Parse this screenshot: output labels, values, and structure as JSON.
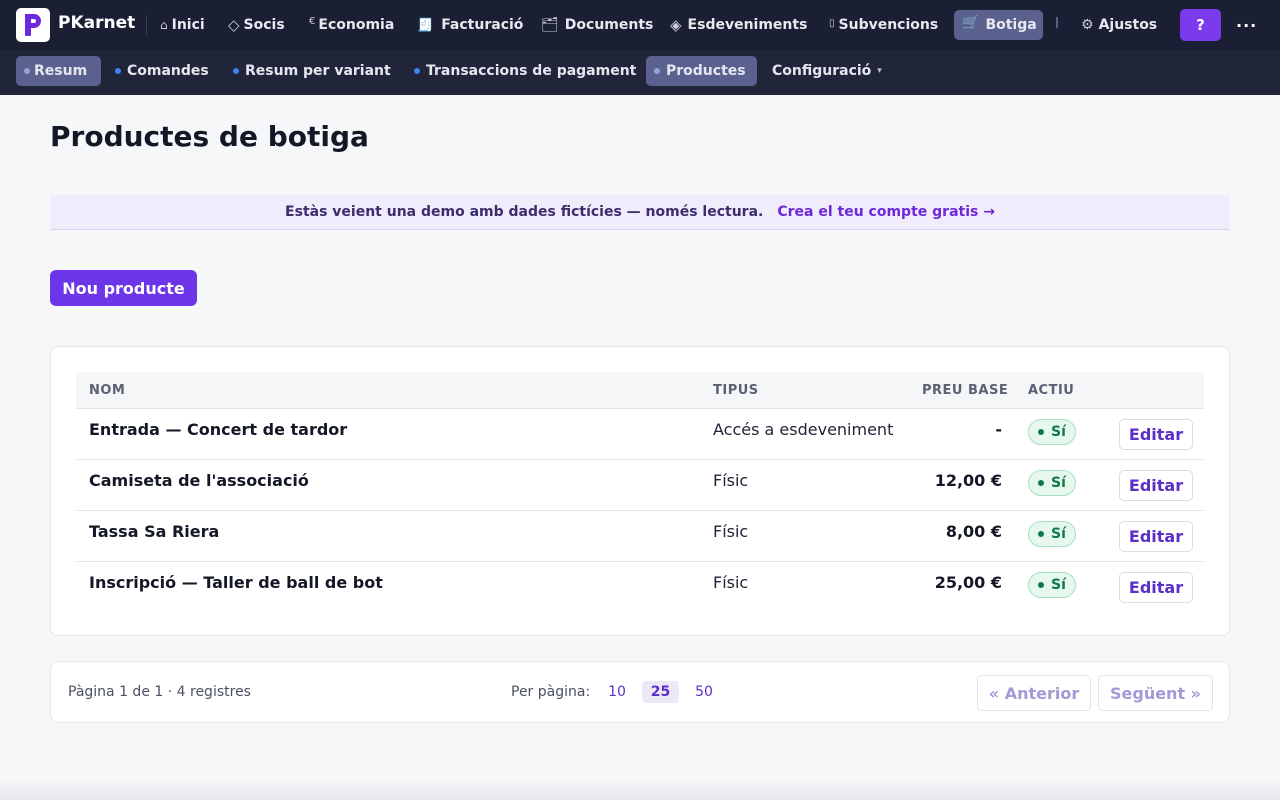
{
  "app": {
    "brand": "PKarnet"
  },
  "topnav": {
    "items": [
      {
        "icon": "⌂",
        "label": "Inici"
      },
      {
        "icon": "◇",
        "label": "Socis"
      },
      {
        "icon": "€",
        "label": "Economia"
      },
      {
        "icon": "🧾",
        "label": "Facturació"
      },
      {
        "icon": "🗂",
        "label": "Documents"
      },
      {
        "icon": "◈",
        "label": "Esdeveniments"
      },
      {
        "icon": "▯",
        "label": "Subvencions"
      },
      {
        "icon": "🛒",
        "label": "Botiga"
      },
      {
        "icon": "⚙",
        "label": "Ajustos"
      }
    ],
    "active": "Botiga",
    "help_label": "?",
    "more_label": "..."
  },
  "subnav": {
    "items": [
      {
        "label": "Resum"
      },
      {
        "label": "Comandes"
      },
      {
        "label": "Resum per variant"
      },
      {
        "label": "Transaccions de pagament"
      },
      {
        "label": "Productes"
      },
      {
        "label": "Configuració"
      }
    ],
    "active": [
      "Resum",
      "Productes"
    ]
  },
  "page": {
    "title": "Productes de botiga",
    "demo_banner": {
      "text": "Estàs veient una demo amb dades fictícies — només lectura.",
      "link": "Crea el teu compte gratis →"
    },
    "new_button": "Nou producte"
  },
  "table": {
    "headers": {
      "name": "NOM",
      "type": "TIPUS",
      "price": "PREU BASE",
      "active": "ACTIU"
    },
    "rows": [
      {
        "name": "Entrada — Concert de tardor",
        "type": "Accés a esdeveniment",
        "price": "-",
        "active": "Sí",
        "action": "Editar"
      },
      {
        "name": "Camiseta de l'associació",
        "type": "Físic",
        "price": "12,00 €",
        "active": "Sí",
        "action": "Editar"
      },
      {
        "name": "Tassa Sa Riera",
        "type": "Físic",
        "price": "8,00 €",
        "active": "Sí",
        "action": "Editar"
      },
      {
        "name": "Inscripció — Taller de ball de bot",
        "type": "Físic",
        "price": "25,00 €",
        "active": "Sí",
        "action": "Editar"
      }
    ]
  },
  "pagination": {
    "info": "Pàgina 1 de 1 · 4 registres",
    "per_page_label": "Per pàgina:",
    "per_page_options": [
      "10",
      "25",
      "50"
    ],
    "per_page_selected": "25",
    "prev": "« Anterior",
    "next": "Següent »"
  },
  "colors": {
    "accent": "#6d35e8",
    "nav_bg": "#1b1f33",
    "success": "#0f7a45"
  }
}
